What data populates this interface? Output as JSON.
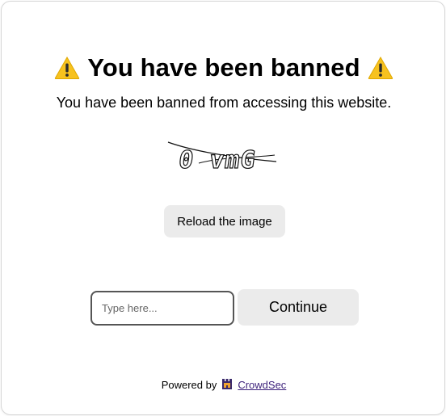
{
  "page": {
    "title": "You have been banned",
    "subtitle": "You have been banned from accessing this website."
  },
  "captcha": {
    "text": "0 vmG",
    "reload_label": "Reload the image"
  },
  "form": {
    "input_placeholder": "Type here...",
    "input_value": "",
    "continue_label": "Continue"
  },
  "footer": {
    "powered_by": "Powered by",
    "link_label": "CrowdSec"
  },
  "icons": {
    "title_left": "warning-icon",
    "title_right": "warning-icon",
    "brand": "crowdsec-logo-icon"
  },
  "colors": {
    "warning": "#f7c21f",
    "button_bg": "#ebebeb",
    "link": "#3b1f7a"
  }
}
